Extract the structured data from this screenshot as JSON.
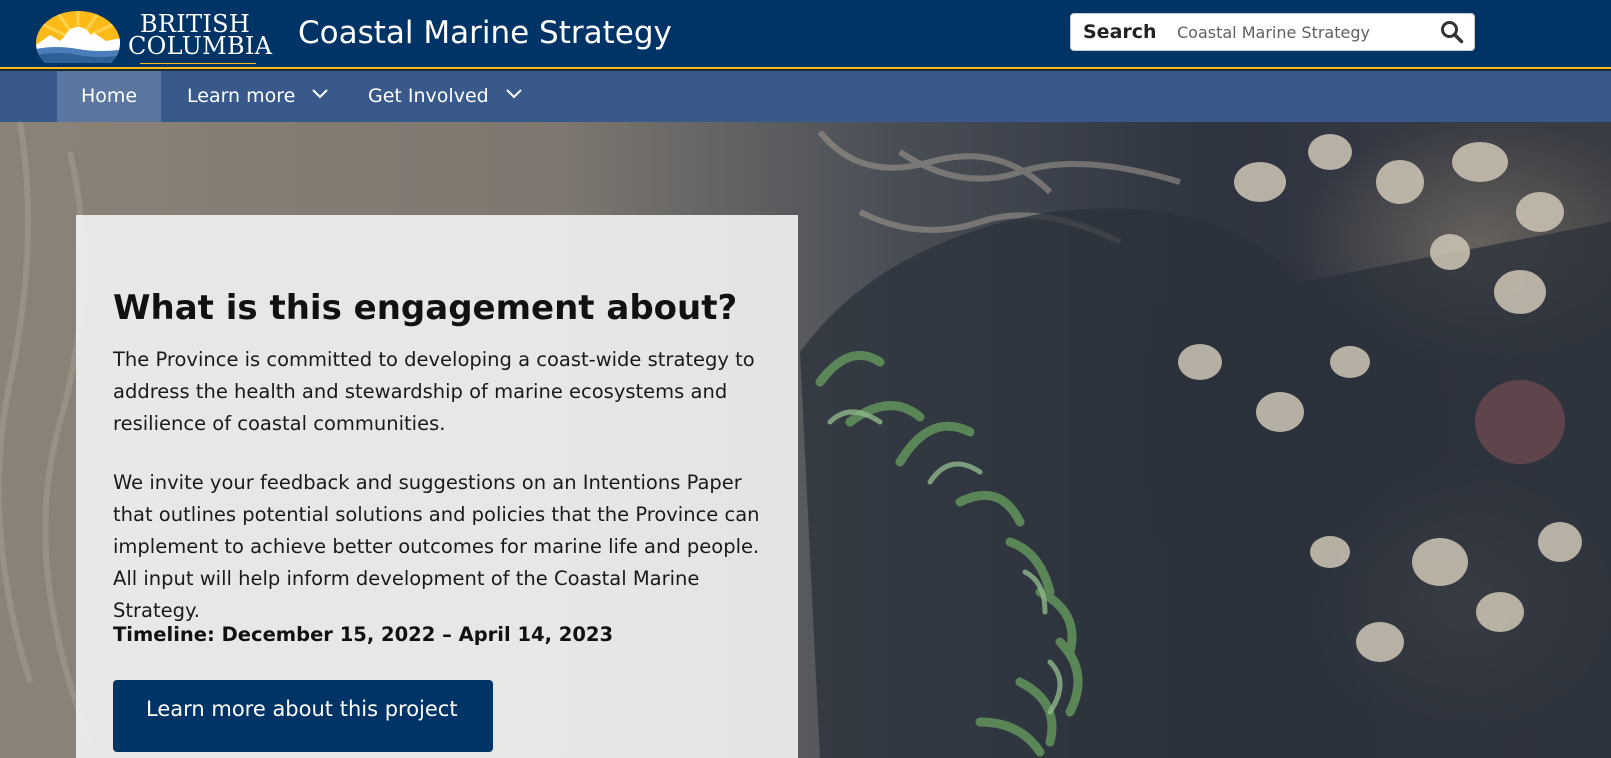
{
  "header": {
    "logo_line1": "BRITISH",
    "logo_line2": "COLUMBIA",
    "site_title": "Coastal Marine Strategy",
    "search_label": "Search",
    "search_placeholder": "Coastal Marine Strategy"
  },
  "nav": {
    "items": [
      {
        "label": "Home",
        "active": true
      },
      {
        "label": "Learn more",
        "dropdown": true
      },
      {
        "label": "Get Involved",
        "dropdown": true
      }
    ]
  },
  "hero": {
    "heading": "What is this engagement about?",
    "paragraph1": "The Province is committed to developing a coast-wide strategy to address the health and stewardship of marine ecosystems and resilience of coastal communities.",
    "paragraph2": "We invite your feedback and suggestions on an Intentions Paper that outlines potential solutions and policies that the Province can implement to achieve better outcomes for marine life and people. All input will help inform development of the Coastal Marine Strategy.",
    "timeline": "Timeline: December 15, 2022 – April 14, 2023",
    "cta_label": "Learn more about this project"
  },
  "colors": {
    "header_bg": "#003366",
    "nav_bg": "#38598a",
    "nav_active_bg": "#5b76a0",
    "accent_gold": "#fcba19",
    "button_bg": "#003366"
  },
  "icons": {
    "search": "magnifier-icon",
    "chevron": "chevron-down-icon",
    "logo": "bc-sun-logo"
  }
}
